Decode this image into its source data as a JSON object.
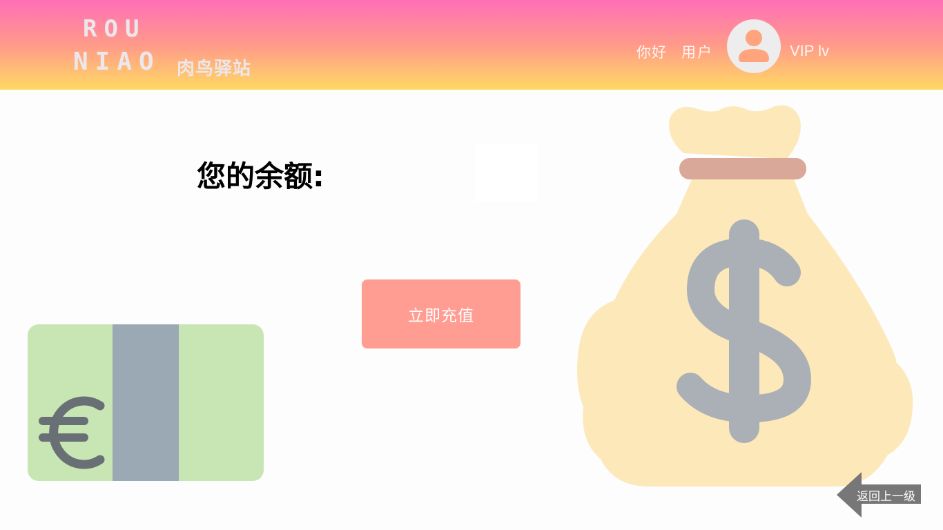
{
  "header": {
    "logo_line_1": "ROU",
    "logo_line_2": "NIAO",
    "logo_cn": "肉鸟驿站",
    "greeting": "你好",
    "username": "用户",
    "vip_label": "VIP lv"
  },
  "main": {
    "balance_label": "您的余额:",
    "balance_value": "",
    "recharge_label": "立即充值",
    "back_label": "返回上一级"
  },
  "icons": {
    "avatar": "user-avatar-icon",
    "euro": "euro-banknote-icon",
    "money_bag": "money-bag-icon",
    "back": "back-arrow-icon"
  },
  "colors": {
    "header_top": "#ff6fb7",
    "header_bottom": "#ffd964",
    "recharge_button": "#ff9d92",
    "back_button": "#777777"
  }
}
